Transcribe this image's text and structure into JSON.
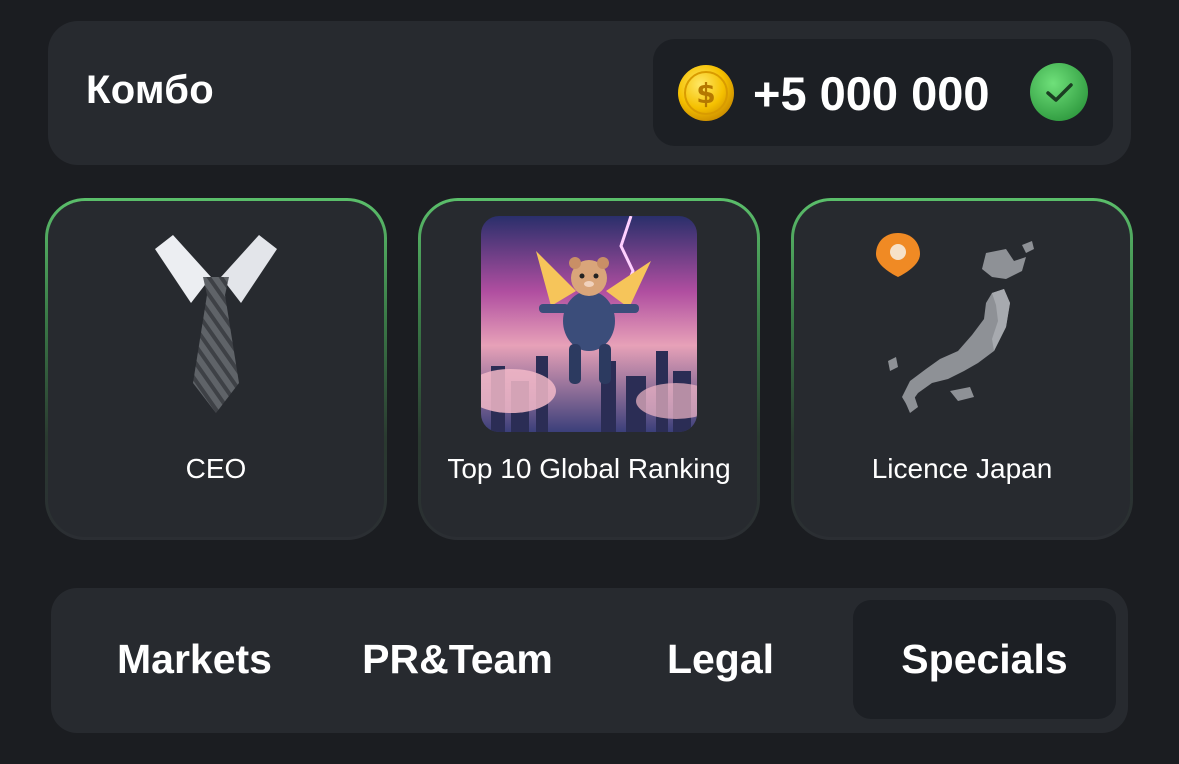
{
  "combo": {
    "title": "Комбо",
    "reward": "+5 000 000",
    "coin_icon": "coin-icon",
    "status_icon": "check-circle-icon",
    "accent_color": "#4caf50"
  },
  "cards": [
    {
      "label": "CEO",
      "icon": "necktie-icon",
      "completed": true
    },
    {
      "label": "Top 10 Global Ranking",
      "icon": "flying-hamster-image",
      "completed": true
    },
    {
      "label": "Licence Japan",
      "icon": "japan-map-icon",
      "completed": true
    }
  ],
  "tabs": [
    {
      "label": "Markets",
      "active": false
    },
    {
      "label": "PR&Team",
      "active": false
    },
    {
      "label": "Legal",
      "active": false
    },
    {
      "label": "Specials",
      "active": true
    }
  ]
}
